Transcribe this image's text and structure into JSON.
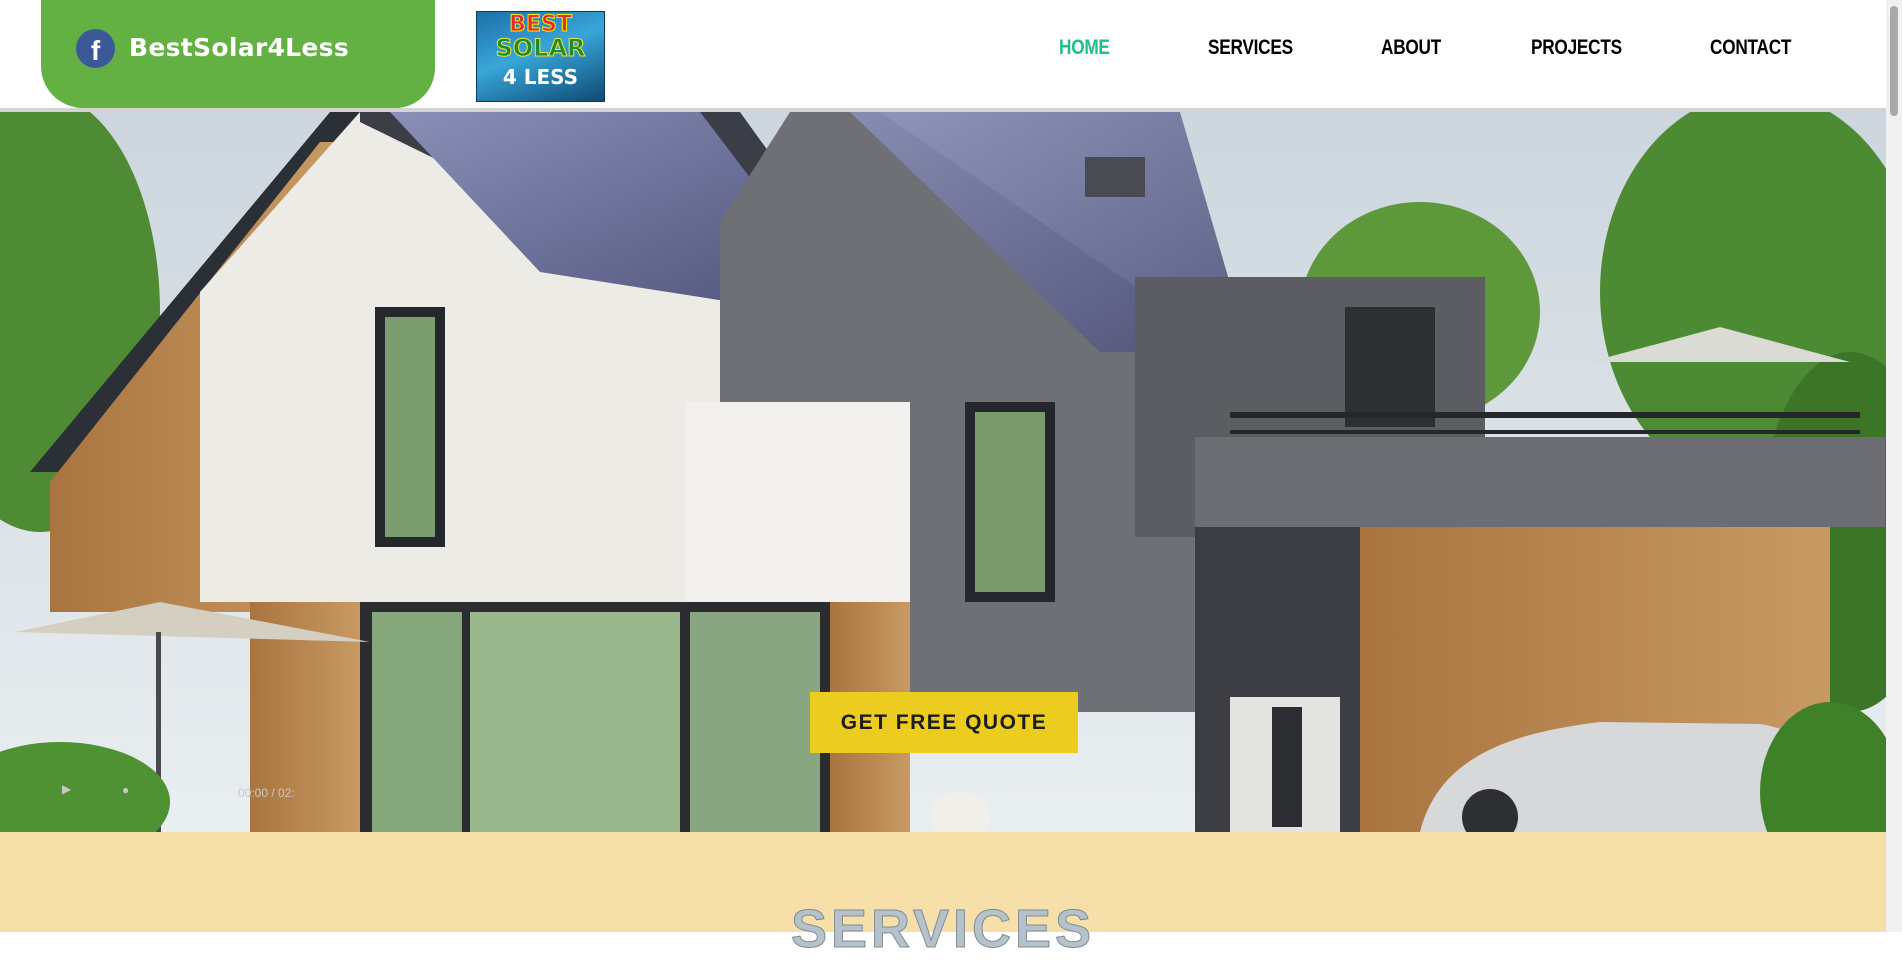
{
  "header": {
    "brand": "BestSolar4Less",
    "facebook_glyph": "f",
    "logo": {
      "line1": "BEST",
      "line2": "SOLAR",
      "line3": "4 LESS"
    },
    "nav": [
      {
        "label": "HOME",
        "active": true
      },
      {
        "label": "SERVICES",
        "active": false
      },
      {
        "label": "ABOUT",
        "active": false
      },
      {
        "label": "PROJECTS",
        "active": false
      },
      {
        "label": "CONTACT",
        "active": false
      }
    ]
  },
  "hero": {
    "cta_label": "GET FREE QUOTE",
    "video_time": "00:00 / 02:"
  },
  "services": {
    "heading": "SERVICES"
  },
  "colors": {
    "accent_green": "#63b043",
    "nav_active": "#1cc08a",
    "cta": "#ebcc1f",
    "services_bg": "#f7dfaa"
  }
}
